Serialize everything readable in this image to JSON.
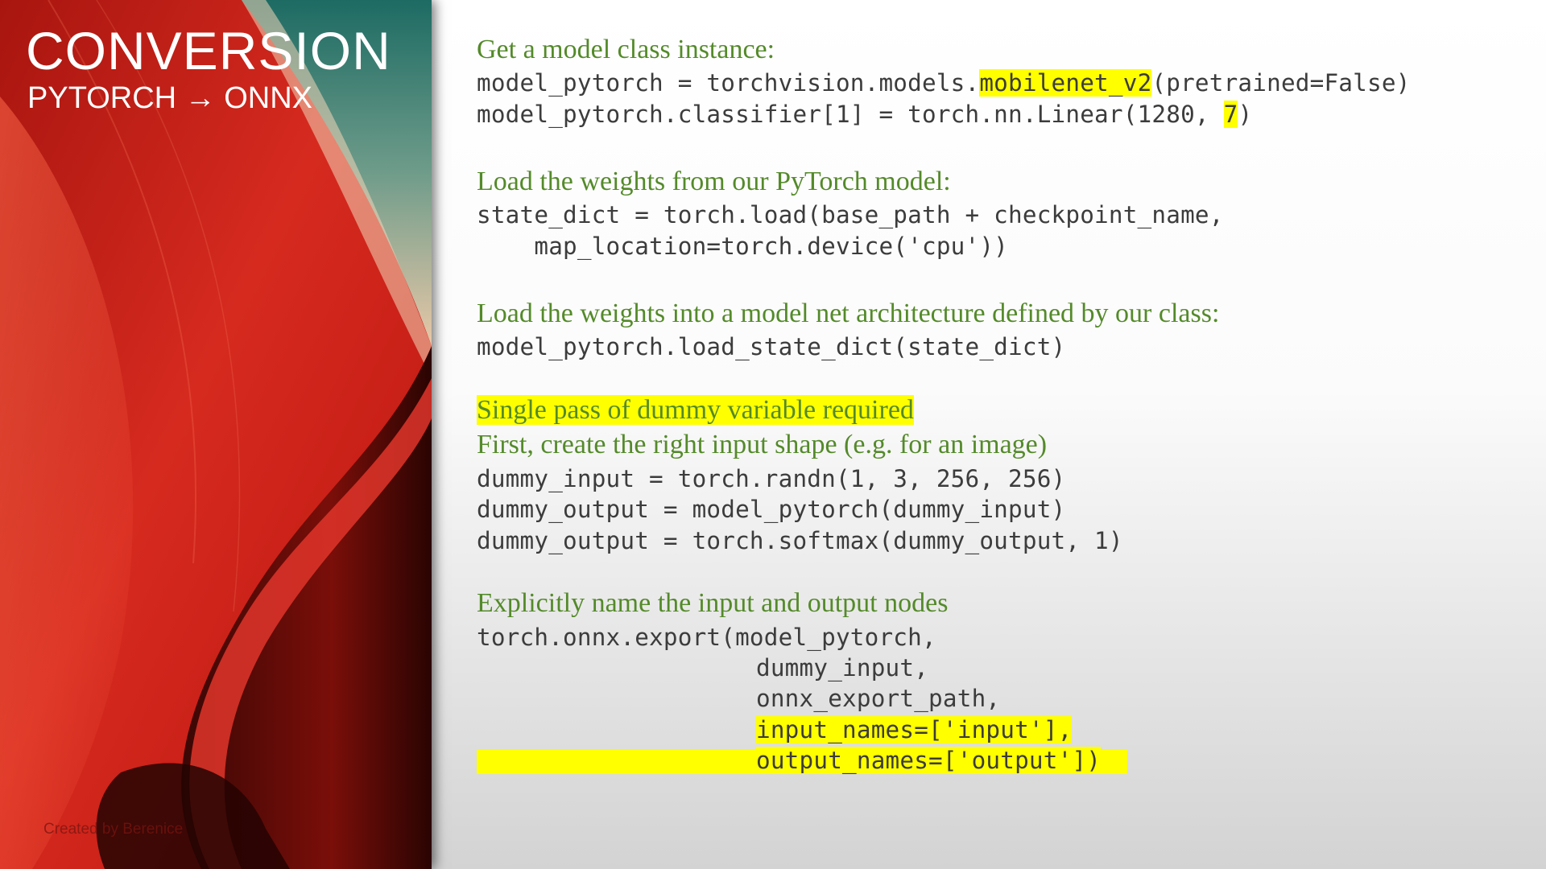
{
  "slide": {
    "title": "CONVERSION",
    "subtitle_left": "PYTORCH",
    "subtitle_arrow": "→",
    "subtitle_right": "ONNX",
    "credit": "Created by Berenice"
  },
  "colors": {
    "comment_green": "#548a2a",
    "code_gray": "#3c3c3c",
    "highlight_yellow": "#ffff00",
    "panel_red": "#c11a14"
  },
  "sections": {
    "model": {
      "heading": "Get a model class instance:",
      "line1_pre": "model_pytorch = torchvision.models.",
      "line1_hl": "mobilenet_v2",
      "line1_post": "(pretrained=False)",
      "line2_pre": "model_pytorch.classifier[1] = torch.nn.Linear(1280, ",
      "line2_hl": "7",
      "line2_post": ")"
    },
    "load": {
      "heading": "Load the weights from our PyTorch model:",
      "line1": "state_dict = torch.load(base_path + checkpoint_name,",
      "line2": "    map_location=torch.device('cpu'))"
    },
    "arch": {
      "heading": "Load the weights into a model net architecture defined by our class:",
      "line1": "model_pytorch.load_state_dict(state_dict)"
    },
    "dummy": {
      "heading_hl": "Single pass of dummy variable required",
      "heading2": "First, create the right input shape (e.g. for an image)",
      "line1": "dummy_input = torch.randn(1, 3, 256, 256)",
      "line2": "dummy_output = model_pytorch(dummy_input)",
      "line3": "dummy_output = torch.softmax(dummy_output, 1)"
    },
    "export": {
      "heading": "Explicitly name the input and output nodes",
      "line1": "torch.onnx.export(model_pytorch,",
      "line2": "dummy_input,",
      "line3": "onnx_export_path,",
      "line4": "input_names=['input'],",
      "line5": "output_names=['output'])"
    }
  }
}
